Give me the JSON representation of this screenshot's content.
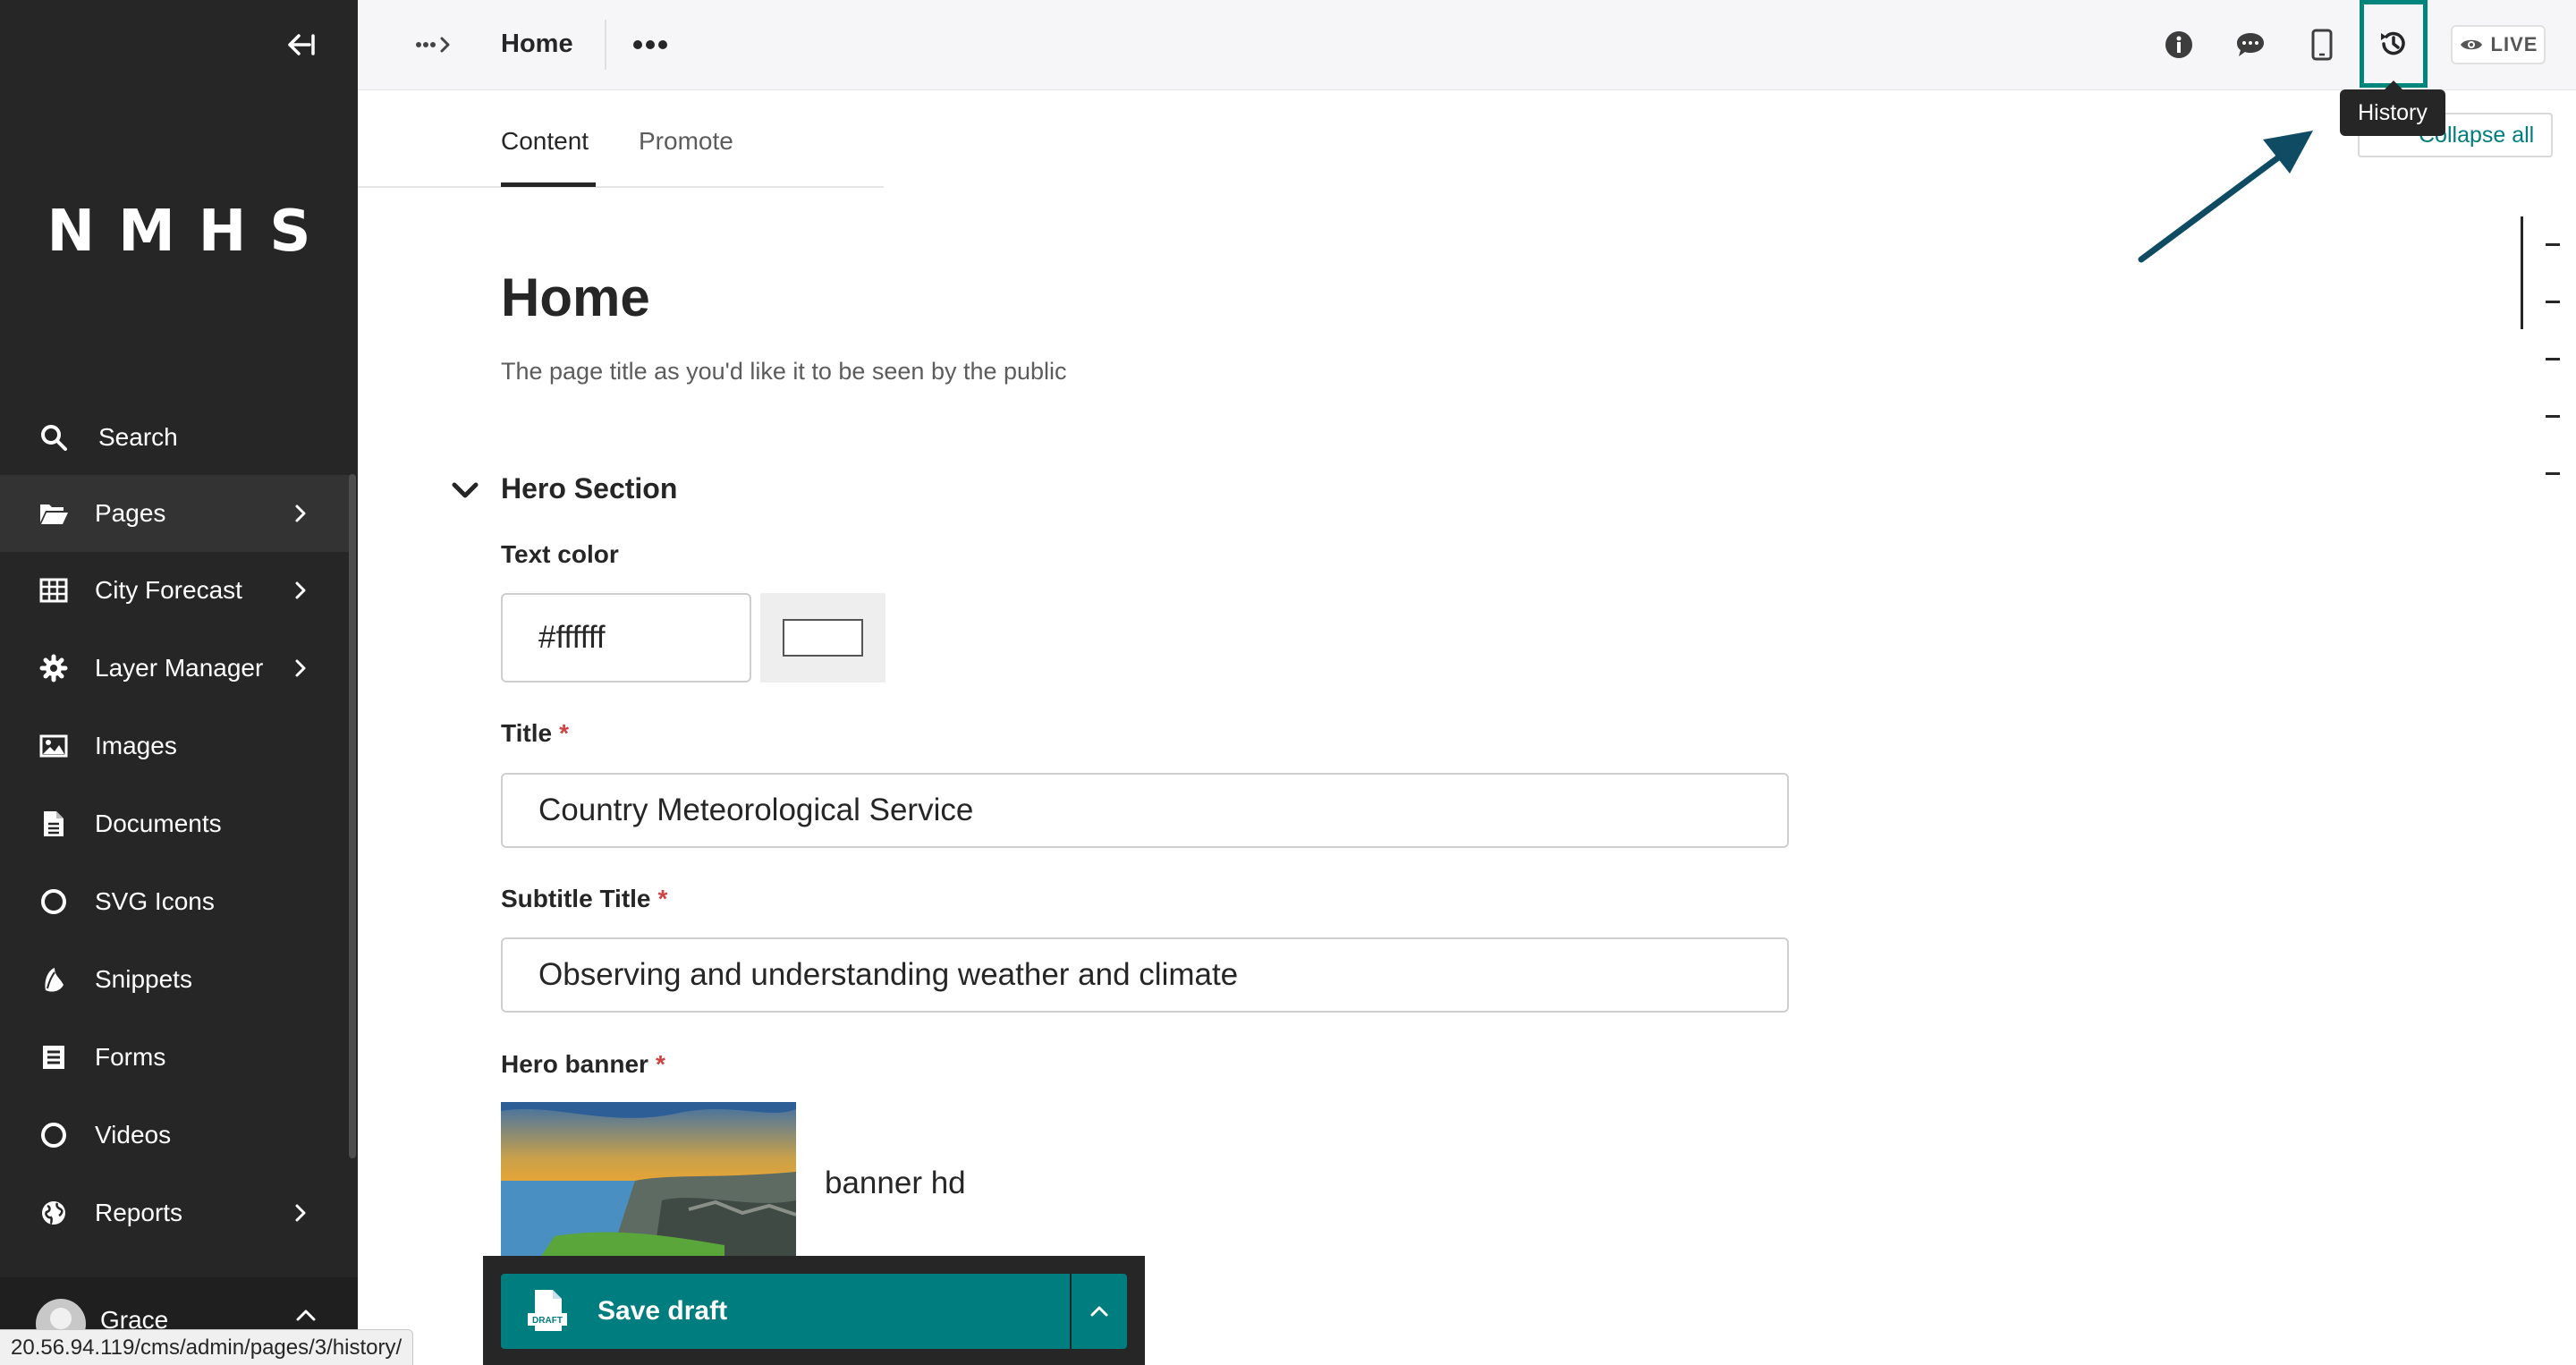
{
  "sidebar": {
    "logo": "NMHS",
    "items": [
      {
        "label": "Search",
        "icon": "search-icon"
      },
      {
        "label": "Pages",
        "icon": "folder-open-icon",
        "has_submenu": true
      },
      {
        "label": "City Forecast",
        "icon": "table-icon",
        "has_submenu": true
      },
      {
        "label": "Layer Manager",
        "icon": "gear-icon",
        "has_submenu": true
      },
      {
        "label": "Images",
        "icon": "image-icon"
      },
      {
        "label": "Documents",
        "icon": "document-icon"
      },
      {
        "label": "SVG Icons",
        "icon": "circle-icon"
      },
      {
        "label": "Snippets",
        "icon": "leaf-icon"
      },
      {
        "label": "Forms",
        "icon": "form-icon"
      },
      {
        "label": "Videos",
        "icon": "circle-icon"
      },
      {
        "label": "Reports",
        "icon": "globe-icon",
        "has_submenu": true
      }
    ],
    "account": {
      "name": "Grace"
    }
  },
  "header": {
    "title": "Home",
    "live_label": "LIVE",
    "history_tooltip": "History",
    "icons": [
      "breadcrumb-toggle-icon",
      "more-icon",
      "info-icon",
      "comment-icon",
      "mobile-preview-icon",
      "history-icon",
      "eye-icon"
    ]
  },
  "tabs": [
    {
      "label": "Content",
      "active": true
    },
    {
      "label": "Promote",
      "active": false
    }
  ],
  "collapse_all_label": "Collapse all",
  "form": {
    "page_title": "Home",
    "page_title_help": "The page title as you'd like it to be seen by the public",
    "section_title": "Hero Section",
    "text_color_label": "Text color",
    "text_color_value": "#ffffff",
    "title_label": "Title",
    "title_value": "Country Meteorological Service",
    "subtitle_label": "Subtitle Title",
    "subtitle_value": "Observing and understanding weather and climate",
    "hero_banner_label": "Hero banner",
    "hero_banner_name": "banner hd",
    "required_mark": "*"
  },
  "footer": {
    "save_label": "Save draft",
    "save_icon_text": "DRAFT"
  },
  "status_url": "20.56.94.119/cms/admin/pages/3/history/",
  "colors": {
    "sidebar_bg": "#262626",
    "accent": "#007d7e",
    "highlight_box": "#00857c",
    "annotation_arrow": "#0f4c64",
    "required": "#cd4444"
  }
}
